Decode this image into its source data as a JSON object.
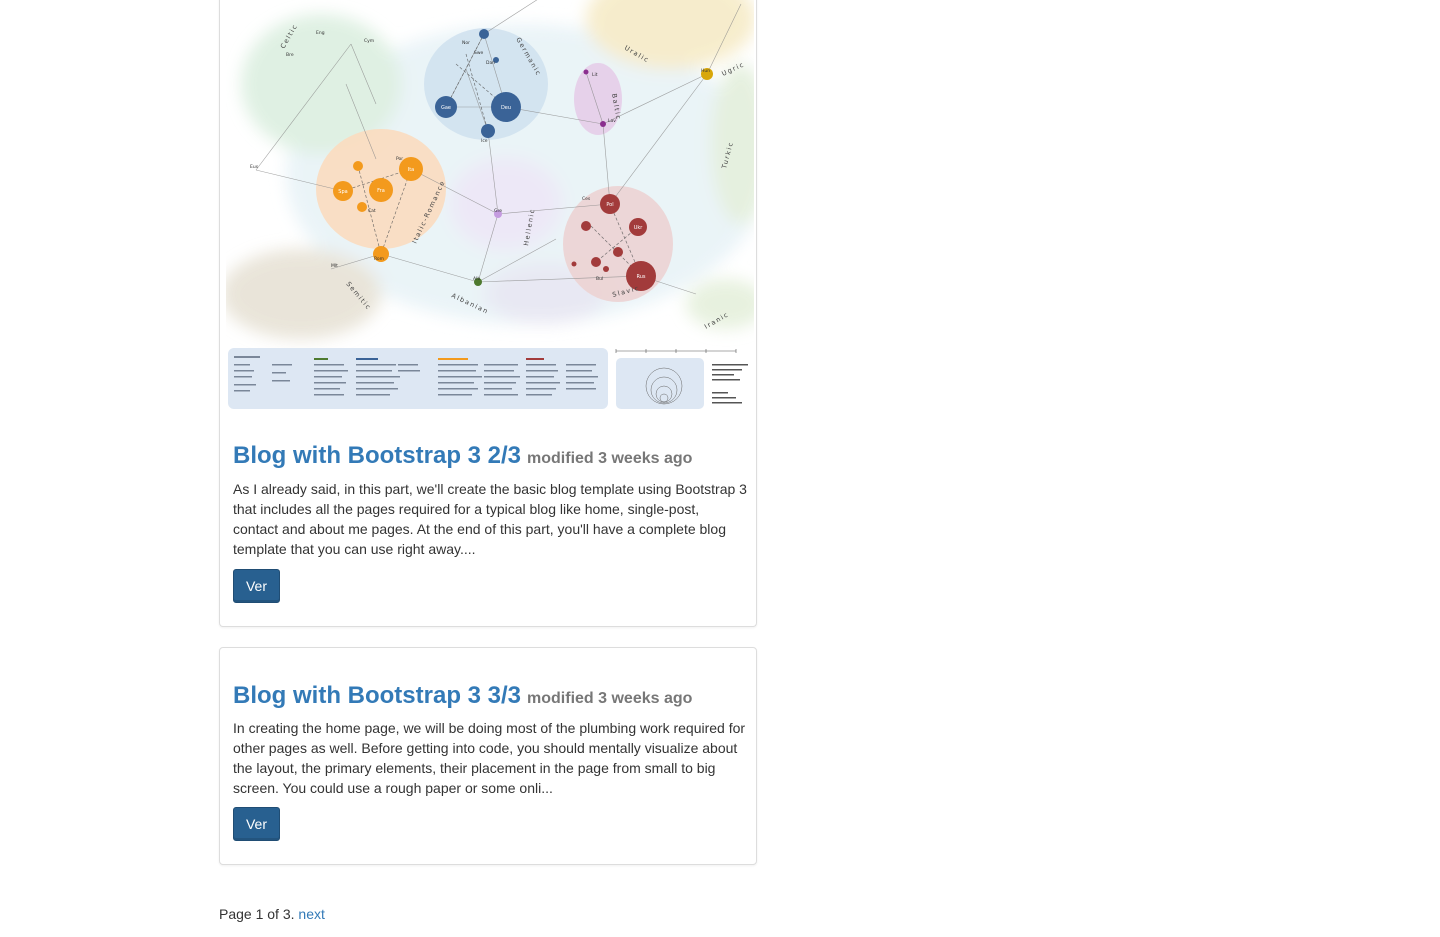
{
  "posts": [
    {
      "title": "Blog with Bootstrap 3 2/3",
      "meta": "modified 3 weeks ago",
      "excerpt": "As I already said, in this part, we'll create the basic blog template using Bootstrap 3 that includes all the pages required for a typical blog like home, single-post, contact and about me pages. At the end of this part, you'll have a complete blog template that you can use right away....",
      "button_label": "Ver",
      "image": {
        "group_labels": [
          "Celtic",
          "Germanic",
          "Uralic",
          "Ugric",
          "Baltic",
          "Italic-Romance",
          "Hellenic",
          "Slavic",
          "Albanian",
          "Semitic",
          "Turkic",
          "Iranic"
        ],
        "node_labels": [
          "Gae",
          "Bre",
          "Cym",
          "Eng",
          "Deu",
          "Nor",
          "Swe",
          "Dan",
          "Ice",
          "Lit",
          "Lav",
          "Hun",
          "Fra",
          "Ita",
          "Spa",
          "Por",
          "Cat",
          "Rom",
          "Gre",
          "Alb",
          "Pol",
          "Ces",
          "Ukr",
          "Rus",
          "Bul",
          "Mlt",
          "Eus"
        ]
      }
    },
    {
      "title": "Blog with Bootstrap 3 3/3",
      "meta": "modified 3 weeks ago",
      "excerpt": "In creating the home page, we will be doing most of the plumbing work required for other pages as well. Before getting into code, you should mentally visualize about the layout, the primary elements, their placement in the page from small to big screen. You could use a rough paper or some onli...",
      "button_label": "Ver"
    }
  ],
  "pagination": {
    "text": "Page 1 of 3.",
    "next_label": "next"
  },
  "colors": {
    "link": "#337ab7",
    "button": "#286090",
    "muted": "#777777"
  }
}
